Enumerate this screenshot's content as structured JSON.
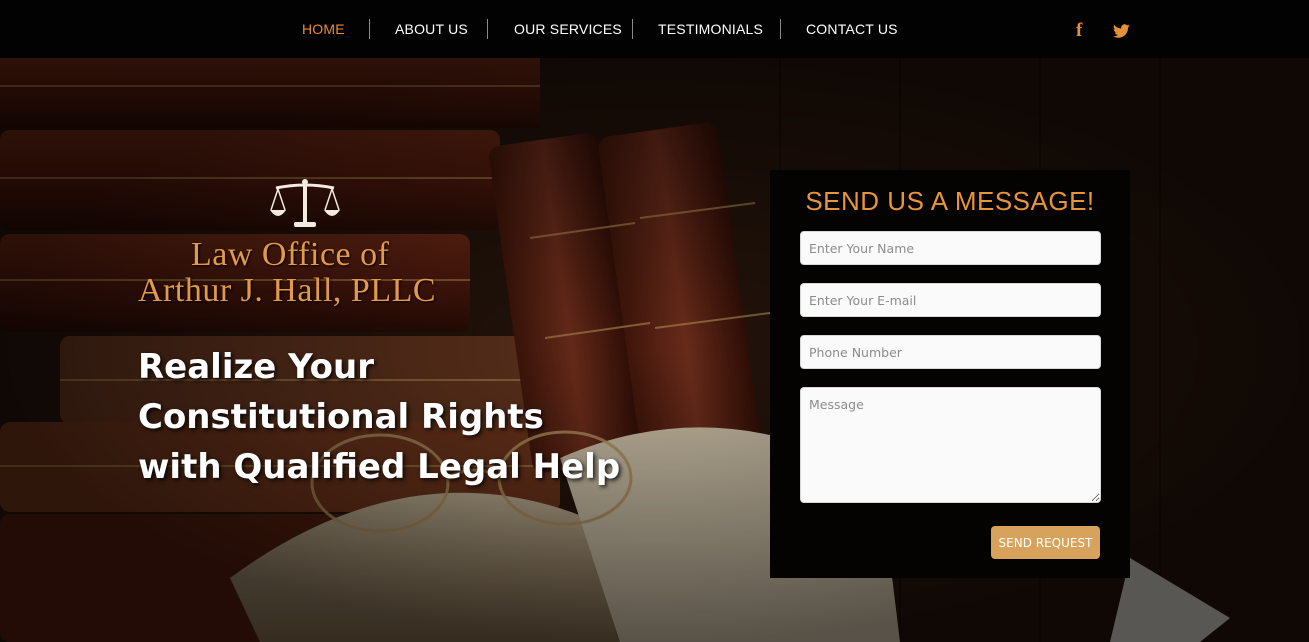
{
  "nav": {
    "items": [
      {
        "label": "HOME",
        "active": true
      },
      {
        "label": "ABOUT US"
      },
      {
        "label": "OUR SERVICES"
      },
      {
        "label": "TESTIMONIALS"
      },
      {
        "label": "CONTACT US"
      }
    ],
    "social": {
      "facebook": "f",
      "facebook_icon": "facebook-icon",
      "twitter_icon": "twitter-icon"
    }
  },
  "hero": {
    "logo": {
      "icon": "scales-of-justice-icon",
      "line1": "Law Office of",
      "line2": "Arthur J. Hall, PLLC"
    },
    "headline": "Realize Your Constitutional Rights with Qualified Legal Help"
  },
  "contact_form": {
    "title": "SEND US A MESSAGE!",
    "name_placeholder": "Enter Your Name",
    "email_placeholder": "Enter Your E-mail",
    "phone_placeholder": "Phone Number",
    "message_placeholder": "Message",
    "submit_label": "SEND REQUEST"
  },
  "colors": {
    "accent": "#e8943c",
    "nav_bg": "#020202",
    "button": "#d7a35c"
  }
}
